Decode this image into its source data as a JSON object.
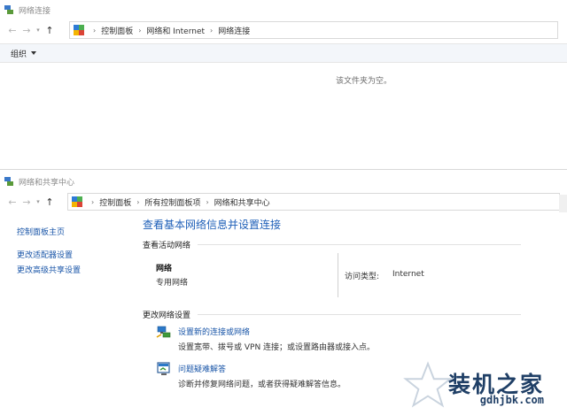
{
  "window1": {
    "title": "网络连接",
    "breadcrumb": [
      "控制面板",
      "网络和 Internet",
      "网络连接"
    ],
    "organize_label": "组织",
    "empty_message": "该文件夹为空。"
  },
  "window2": {
    "title": "网络和共享中心",
    "breadcrumb": [
      "控制面板",
      "所有控制面板项",
      "网络和共享中心"
    ],
    "sidebar": {
      "items": [
        {
          "label": "控制面板主页"
        },
        {
          "label": "更改适配器设置"
        },
        {
          "label": "更改高级共享设置"
        }
      ]
    },
    "main": {
      "heading": "查看基本网络信息并设置连接",
      "active_networks_label": "查看活动网络",
      "network": {
        "name": "网络",
        "type": "专用网络",
        "access_type_label": "访问类型:",
        "access_type_value": "Internet"
      },
      "change_settings_label": "更改网络设置",
      "actions": [
        {
          "link": "设置新的连接或网络",
          "desc": "设置宽带、拨号或 VPN 连接；或设置路由器或接入点。"
        },
        {
          "link": "问题疑难解答",
          "desc": "诊断并修复网络问题，或者获得疑难解答信息。"
        }
      ]
    }
  },
  "watermark": {
    "title": "装机之家",
    "url": "gdhjbk.com"
  },
  "colors": {
    "link": "#1a56a8",
    "heading": "#1e5fb8",
    "watermark": "#1f3f66"
  }
}
